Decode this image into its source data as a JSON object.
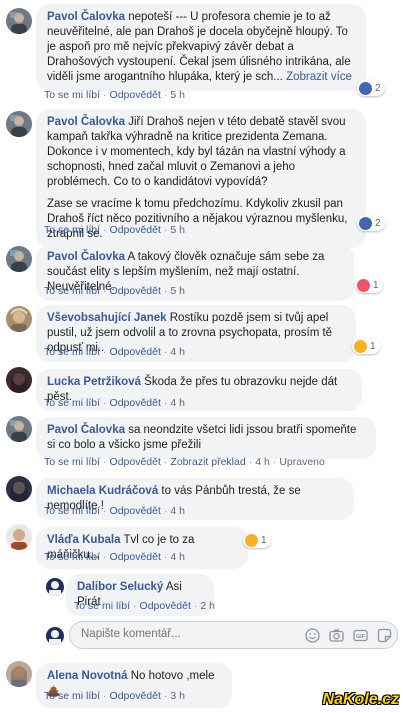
{
  "comments": [
    {
      "author": "Pavol Čalovka",
      "text": "nepoteší --- U profesora chemie je to až neuvěřitelné, ale pan Drahoš je docela obyčejně hloupý. To je aspoň pro mě nejvíc překvapivý závěr debat a Drahošových vystoupení. Čekal jsem úlisného intrikána, ale viděli jsme arogantního hlupáka, který je sch...",
      "more": "Zobrazit více",
      "like": "To se mi líbí",
      "reply": "Odpovědět",
      "time": "5 h",
      "reaction_count": "2",
      "reaction_type": "like"
    },
    {
      "author": "Pavol Čalovka",
      "text": "Jiří Drahoš nejen v této debatě stavěl svou kampaň takřka výhradně na kritice prezidenta Zemana. Dokonce i v momentech, kdy byl tázán na vlastní výhody a schopnosti, hned začal mluvit o Zemanovi a jeho problémech. Co to o kandidátovi vypovídá?",
      "text2": "Zase se vracíme k tomu předchozímu. Kdykoliv zkusil pan Drahoš říct něco pozitivního a nějakou výraznou myšlenku, ztrapnil se.",
      "like": "To se mi líbí",
      "reply": "Odpovědět",
      "time": "5 h",
      "reaction_count": "2",
      "reaction_type": "like"
    },
    {
      "author": "Pavol Čalovka",
      "text": "A takový člověk označuje sám sebe za součást elity s lepším myšlením, než mají ostatní. Neuvěřitelné.",
      "like": "To se mi líbí",
      "reply": "Odpovědět",
      "time": "5 h",
      "reaction_count": "1",
      "reaction_type": "love"
    },
    {
      "author": "Vševobsahující Janek",
      "text": "Rostíku pozdě jsem si tvůj apel pustil, už jsem odvolil a to zrovna psychopata, prosím tě odpusť mi..",
      "like": "To se mi líbí",
      "reply": "Odpovědět",
      "time": "4 h",
      "reaction_count": "1",
      "reaction_type": "haha"
    },
    {
      "author": "Lucka Petržiková",
      "text": "Škoda že přes tu obrazovku nejde dát pěst.",
      "like": "To se mi líbí",
      "reply": "Odpovědět",
      "time": "4 h"
    },
    {
      "author": "Pavol Čalovka",
      "text": "sa neondzite všetci lidi jssou bratři spomeňte si co bolo a všicko jsme přežili",
      "like": "To se mi líbí",
      "reply": "Odpovědět",
      "translate": "Zobrazit překlad",
      "time": "4 h",
      "edited": "Upraveno"
    },
    {
      "author": "Michaela Kudráčová",
      "text": "to vás Pánbůh trestá, že se nemodlíte !",
      "like": "To se mi líbí",
      "reply": "Odpovědět",
      "time": "4 h"
    },
    {
      "author": "Vláďa Kubala",
      "text": "Tvl co je to za máňičku...",
      "like": "To se mi líbí",
      "reply": "Odpovědět",
      "time": "4 h",
      "reaction_count": "1",
      "reaction_type": "haha"
    }
  ],
  "reply": {
    "author": "Dalibor Selucký",
    "text": "Asi Pirát",
    "like": "To se mi líbí",
    "reply": "Odpovědět",
    "time": "2 h"
  },
  "reply_box": {
    "placeholder": "Napište komentář..."
  },
  "last_comment": {
    "author": "Alena Novotná",
    "text": "No hotovo ,mele",
    "emoji": "poop",
    "like": "To se mi líbí",
    "reply": "Odpovědět",
    "time": "3 h"
  },
  "watermark": "NaKole.cz",
  "colors": {
    "link": "#385898",
    "bubble": "#f2f3f5",
    "like": "#4267b2",
    "love": "#f25268",
    "haha": "#f7b125"
  }
}
